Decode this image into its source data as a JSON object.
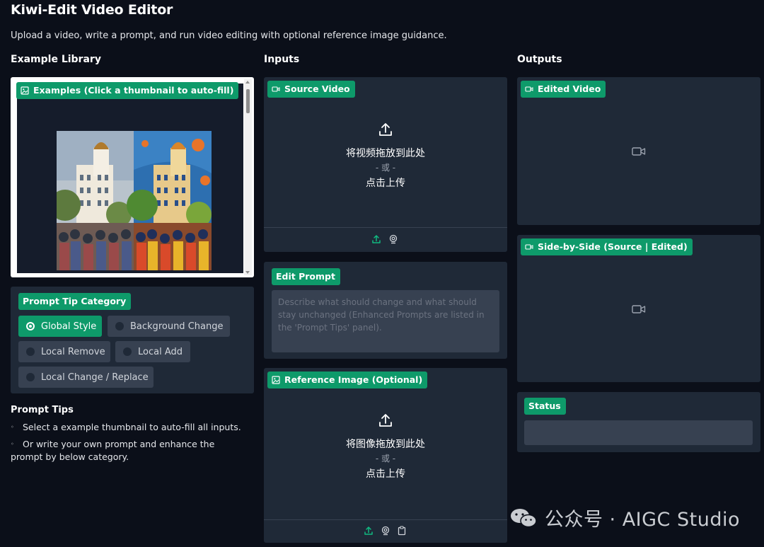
{
  "app": {
    "title": "Kiwi-Edit Video Editor",
    "subtitle": "Upload a video, write a prompt, and run video editing with optional reference image guidance."
  },
  "columns": {
    "library": "Example Library",
    "inputs": "Inputs",
    "outputs": "Outputs"
  },
  "examples": {
    "label": "Examples (Click a thumbnail to auto-fill)"
  },
  "prompt_category": {
    "label": "Prompt Tip Category",
    "options": [
      "Global Style",
      "Background Change",
      "Local Remove",
      "Local Add",
      "Local Change / Replace"
    ],
    "selected": "Global Style"
  },
  "tips": {
    "heading": "Prompt Tips",
    "items": [
      "Select a example thumbnail to auto-fill all inputs.",
      "Or write your own prompt and enhance the prompt by below category."
    ]
  },
  "source_video": {
    "label": "Source Video",
    "drop_text": "将视频拖放到此处",
    "or_text": "- 或 -",
    "click_text": "点击上传"
  },
  "edit_prompt": {
    "label": "Edit Prompt",
    "placeholder": "Describe what should change and what should stay unchanged (Enhanced Prompts are listed in the 'Prompt Tips' panel)."
  },
  "reference_image": {
    "label": "Reference Image (Optional)",
    "drop_text": "将图像拖放到此处",
    "or_text": "- 或 -",
    "click_text": "点击上传"
  },
  "outputs": {
    "edited_label": "Edited Video",
    "sbs_label": "Side-by-Side (Source | Edited)",
    "status_label": "Status",
    "status_value": ""
  },
  "watermark": {
    "text": "公众号 · AIGC Studio"
  },
  "colors": {
    "accent": "#0e9a6a",
    "background": "#0b0f19",
    "panel": "#1f2937",
    "field": "#374151"
  },
  "icons": {
    "image": "image-icon",
    "video": "video-icon",
    "upload": "upload-icon",
    "webcam": "webcam-icon",
    "clipboard": "clipboard-icon"
  }
}
